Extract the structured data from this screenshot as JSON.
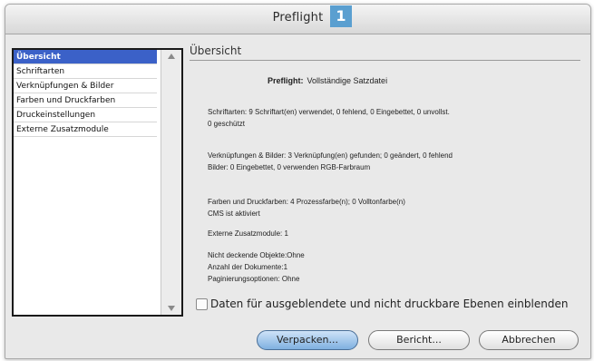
{
  "window": {
    "title": "Preflight",
    "badge": "1"
  },
  "sidebar": {
    "items": [
      {
        "label": "Übersicht",
        "selected": true
      },
      {
        "label": "Schriftarten",
        "selected": false
      },
      {
        "label": "Verknüpfungen & Bilder",
        "selected": false
      },
      {
        "label": "Farben und Druckfarben",
        "selected": false
      },
      {
        "label": "Druckeinstellungen",
        "selected": false
      },
      {
        "label": "Externe Zusatzmodule",
        "selected": false
      }
    ]
  },
  "panel": {
    "title": "Übersicht",
    "headline_label": "Preflight:",
    "headline_value": "Vollständige Satzdatei",
    "lines": [
      "Schriftarten: 9 Schriftart(en) verwendet, 0 fehlend, 0 Eingebettet, 0 unvollst.",
      "0 geschützt",
      "Verknüpfungen & Bilder: 3 Verknüpfung(en) gefunden; 0 geändert, 0 fehlend",
      "Bilder: 0 Eingebettet, 0 verwenden RGB-Farbraum",
      "Farben und Druckfarben: 4 Prozessfarbe(n); 0 Volltonfarbe(n)",
      "CMS ist aktiviert",
      "Externe Zusatzmodule: 1",
      "Nicht deckende Objekte:Ohne",
      "Anzahl der Dokumente:1",
      "Paginierungsoptionen: Ohne"
    ],
    "checkbox_label": "Daten für ausgeblendete und nicht druckbare Ebenen einblenden",
    "checkbox_checked": false
  },
  "buttons": {
    "package": "Verpacken...",
    "report": "Bericht...",
    "cancel": "Abbrechen"
  }
}
